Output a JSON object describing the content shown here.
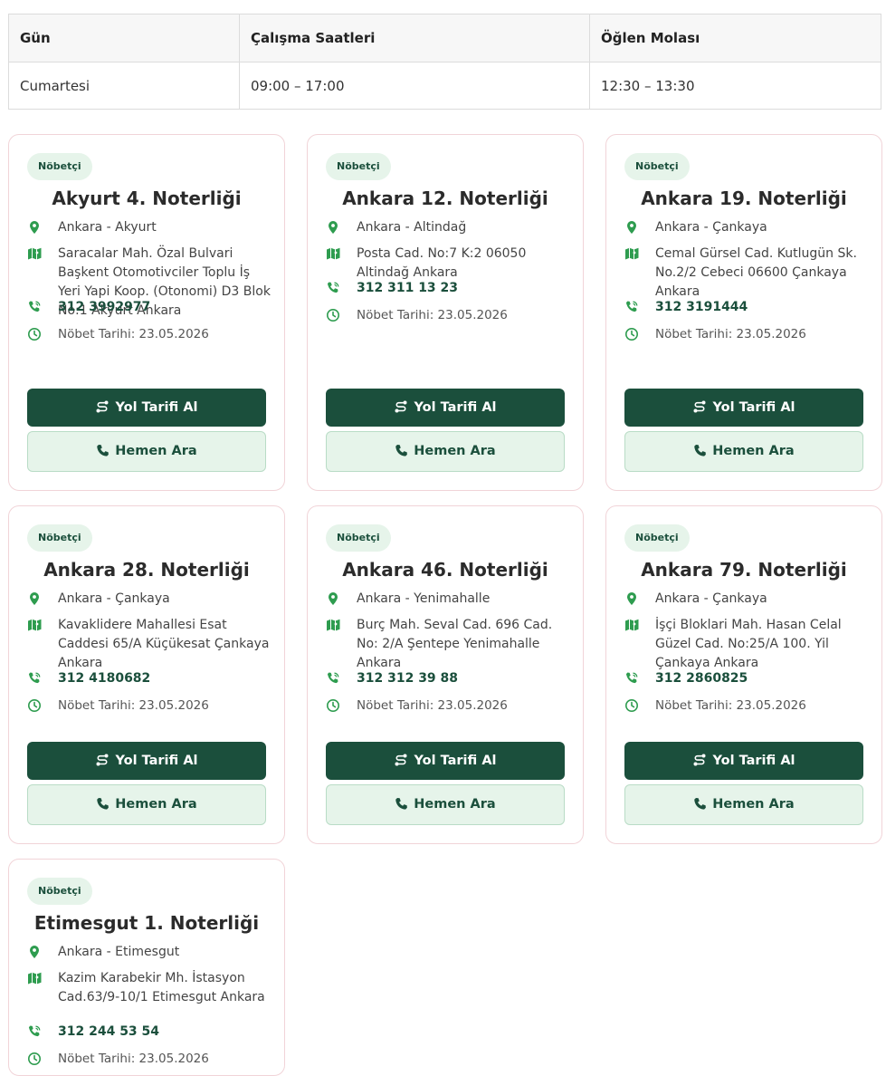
{
  "table": {
    "headers": [
      "Gün",
      "Çalışma Saatleri",
      "Öğlen Molası"
    ],
    "rows": [
      [
        "Cumartesi",
        "09:00 – 17:00",
        "12:30 – 13:30"
      ]
    ]
  },
  "cards": [
    {
      "badge": "Nöbetçi",
      "title": "Akyurt 4. Noterliği",
      "district": "Ankara - Akyurt",
      "address": "Saracalar Mah. Özal Bulvari Başkent Otomotivciler Toplu İş Yeri Yapi Koop. (Otonomi) D3 Blok No:1 Akyurt Ankara",
      "phone": "312 3992977",
      "date": "Nöbet Tarihi: 23.05.2026",
      "directions_label": "Yol Tarifi Al",
      "call_label": "Hemen Ara"
    },
    {
      "badge": "Nöbetçi",
      "title": "Ankara 12. Noterliği",
      "district": "Ankara - Altindağ",
      "address": "Posta Cad. No:7 K:2 06050 Altindağ Ankara",
      "phone": "312 311 13 23",
      "date": "Nöbet Tarihi: 23.05.2026",
      "directions_label": "Yol Tarifi Al",
      "call_label": "Hemen Ara"
    },
    {
      "badge": "Nöbetçi",
      "title": "Ankara 19. Noterliği",
      "district": "Ankara - Çankaya",
      "address": "Cemal Gürsel Cad. Kutlugün Sk. No.2/2 Cebeci 06600 Çankaya Ankara",
      "phone": "312 3191444",
      "date": "Nöbet Tarihi: 23.05.2026",
      "directions_label": "Yol Tarifi Al",
      "call_label": "Hemen Ara"
    },
    {
      "badge": "Nöbetçi",
      "title": "Ankara 28. Noterliği",
      "district": "Ankara - Çankaya",
      "address": "Kavaklidere Mahallesi Esat Caddesi 65/A Küçükesat Çankaya Ankara",
      "phone": "312 4180682",
      "date": "Nöbet Tarihi: 23.05.2026",
      "directions_label": "Yol Tarifi Al",
      "call_label": "Hemen Ara"
    },
    {
      "badge": "Nöbetçi",
      "title": "Ankara 46. Noterliği",
      "district": "Ankara - Yenimahalle",
      "address": "Burç Mah. Seval Cad. 696 Cad. No: 2/A Şentepe Yenimahalle Ankara",
      "phone": "312 312 39 88",
      "date": "Nöbet Tarihi: 23.05.2026",
      "directions_label": "Yol Tarifi Al",
      "call_label": "Hemen Ara"
    },
    {
      "badge": "Nöbetçi",
      "title": "Ankara 79. Noterliği",
      "district": "Ankara - Çankaya",
      "address": "İşçi Bloklari Mah. Hasan Celal Güzel Cad. No:25/A 100. Yil Çankaya Ankara",
      "phone": "312 2860825",
      "date": "Nöbet Tarihi: 23.05.2026",
      "directions_label": "Yol Tarifi Al",
      "call_label": "Hemen Ara"
    },
    {
      "badge": "Nöbetçi",
      "title": "Etimesgut 1. Noterliği",
      "district": "Ankara - Etimesgut",
      "address": "Kazim Karabekir Mh. İstasyon Cad.63/9-10/1 Etimesgut Ankara",
      "phone": "312 244 53 54",
      "date": "Nöbet Tarihi: 23.05.2026",
      "directions_label": "Yol Tarifi Al",
      "call_label": "Hemen Ara"
    }
  ],
  "colors": {
    "primary": "#1b4f3c",
    "badge_bg": "#e6f4ea",
    "icon_green": "#2e9c4f",
    "card_border": "#f1d4d8"
  },
  "icons": {
    "district": "map-pin-icon",
    "address": "map-icon",
    "phone": "phone-icon",
    "date": "clock-icon",
    "directions": "route-icon",
    "call": "phone-icon"
  }
}
